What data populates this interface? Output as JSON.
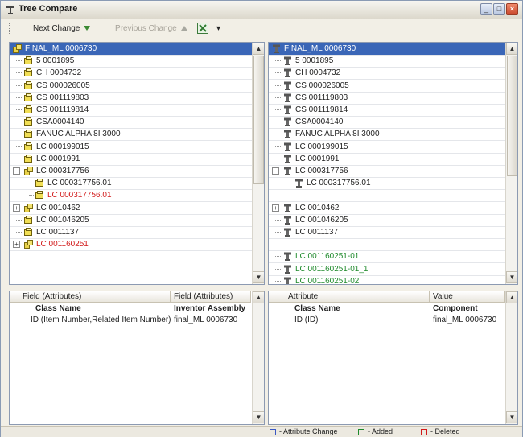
{
  "window": {
    "title": "Tree Compare",
    "minimize_glyph": "_",
    "maximize_glyph": "□",
    "close_glyph": "×"
  },
  "toolbar": {
    "next_change": "Next Change",
    "previous_change": "Previous Change",
    "export_icon": "excel-export-icon",
    "dropdown_glyph": "▾"
  },
  "left_tree": [
    {
      "label": "FINAL_ML 0006730",
      "icon": "assembly-icon",
      "selected": true
    },
    {
      "label": "5 0001895",
      "icon": "part-icon"
    },
    {
      "label": "CH 0004732",
      "icon": "part-icon"
    },
    {
      "label": "CS 000026005",
      "icon": "part-icon"
    },
    {
      "label": "CS 001119803",
      "icon": "part-icon"
    },
    {
      "label": "CS 001119814",
      "icon": "part-icon"
    },
    {
      "label": "CSA0004140",
      "icon": "part-icon"
    },
    {
      "label": "FANUC ALPHA 8I 3000",
      "icon": "part-icon"
    },
    {
      "label": "LC 000199015",
      "icon": "part-icon"
    },
    {
      "label": "LC 0001991",
      "icon": "part-icon"
    },
    {
      "label": "LC 000317756",
      "icon": "assembly-icon",
      "expander": "−"
    },
    {
      "label": "LC 000317756.01",
      "icon": "part-icon",
      "child": true
    },
    {
      "label": "LC 000317756.01",
      "icon": "part-icon",
      "child": true,
      "status": "deleted"
    },
    {
      "label": "LC 0010462",
      "icon": "assembly-icon",
      "expander": "+"
    },
    {
      "label": "LC 001046205",
      "icon": "part-icon"
    },
    {
      "label": "LC 0011137",
      "icon": "part-icon"
    },
    {
      "label": "LC 001160251",
      "icon": "assembly-icon",
      "expander": "+",
      "status": "deleted"
    }
  ],
  "right_tree": [
    {
      "label": "FINAL_ML 0006730",
      "icon": "component-icon",
      "selected": true
    },
    {
      "label": "5 0001895",
      "icon": "component-icon"
    },
    {
      "label": "CH 0004732",
      "icon": "component-icon"
    },
    {
      "label": "CS 000026005",
      "icon": "component-icon"
    },
    {
      "label": "CS 001119803",
      "icon": "component-icon"
    },
    {
      "label": "CS 001119814",
      "icon": "component-icon"
    },
    {
      "label": "CSA0004140",
      "icon": "component-icon"
    },
    {
      "label": "FANUC ALPHA 8I 3000",
      "icon": "component-icon"
    },
    {
      "label": "LC 000199015",
      "icon": "component-icon"
    },
    {
      "label": "LC 0001991",
      "icon": "component-icon"
    },
    {
      "label": "LC 000317756",
      "icon": "component-icon",
      "expander": "−"
    },
    {
      "label": "LC 000317756.01",
      "icon": "component-icon",
      "child": true
    },
    {
      "label": "",
      "blank": true
    },
    {
      "label": "LC 0010462",
      "icon": "component-icon",
      "expander": "+"
    },
    {
      "label": "LC 001046205",
      "icon": "component-icon"
    },
    {
      "label": "LC 0011137",
      "icon": "component-icon"
    },
    {
      "label": "",
      "blank": true
    },
    {
      "label": "LC 001160251-01",
      "icon": "component-icon",
      "status": "added"
    },
    {
      "label": "LC 001160251-01_1",
      "icon": "component-icon",
      "status": "added"
    },
    {
      "label": "LC 001160251-02",
      "icon": "component-icon",
      "status": "added"
    }
  ],
  "left_attrs": {
    "headers": [
      "Field (Attributes)",
      "Field (Attributes)"
    ],
    "rows": [
      [
        "Class Name",
        "Inventor Assembly"
      ],
      [
        "ID (Item Number,Related Item Number)",
        "final_ML 0006730"
      ]
    ]
  },
  "right_attrs": {
    "headers": [
      "Attribute",
      "Value"
    ],
    "rows": [
      [
        "Class Name",
        "Component"
      ],
      [
        "ID (ID)",
        "final_ML 0006730"
      ]
    ]
  },
  "legend": {
    "attribute_change": "- Attribute Change",
    "added": "- Added",
    "deleted": "- Deleted"
  },
  "colors": {
    "selection": "#3a66b7",
    "added": "#1f8a2c",
    "deleted": "#d21a1a",
    "attribute_change": "#3a58c2"
  }
}
